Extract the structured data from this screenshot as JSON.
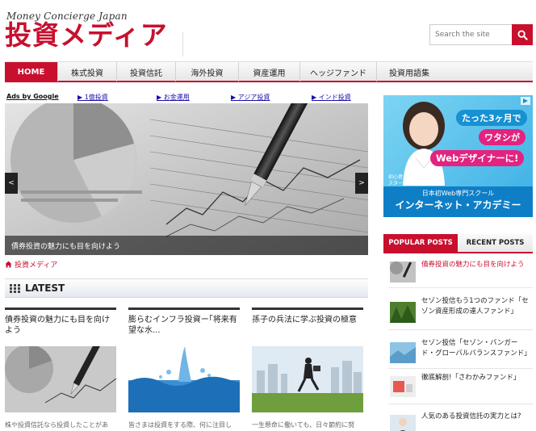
{
  "site": {
    "tagline": "Money Concierge Japan",
    "logo": "投資メディア"
  },
  "search": {
    "placeholder": "Search the site"
  },
  "nav": {
    "items": [
      "HOME",
      "株式投資",
      "投資信託",
      "海外投資",
      "資産運用",
      "ヘッジファンド",
      "投資用語集"
    ]
  },
  "adlinks": {
    "label": "Ads by Google",
    "links": [
      "▶ 1億投資",
      "▶ お金運用",
      "▶ アジア投資",
      "▶ インド投資"
    ]
  },
  "slider": {
    "caption": "債券投資の魅力にも目を向けよう",
    "prev": "<",
    "next": ">"
  },
  "breadcrumb": {
    "label": "投資メディア"
  },
  "latest": {
    "title": "LATEST",
    "cards": [
      {
        "title": "債券投資の魅力にも目を向けよう",
        "excerpt": "株や投資信託なら投資したことがあ"
      },
      {
        "title": "膨らむインフラ投資ー｢将来有望な水...",
        "excerpt": "皆さまは投資をする際、何に注目し"
      },
      {
        "title": "孫子の兵法に学ぶ投資の極意",
        "excerpt": "一生懸命に働いても、日々節約に努"
      }
    ]
  },
  "sidebar_ad": {
    "line1": "たった3ヶ月で",
    "line2": "ワタシが",
    "line3": "Webデザイナーに!",
    "small1": "初心者から",
    "small2": "スタートしたユカさん",
    "school1": "日本初Web専門スクール",
    "school2": "インターネット・アカデミー"
  },
  "sidebar_tabs": {
    "popular": "POPULAR POSTS",
    "recent": "RECENT POSTS"
  },
  "popular_posts": [
    "債券投資の魅力にも目を向けよう",
    "セゾン投信もう1つのファンド「セゾン資産形成の達人ファンド」",
    "セゾン投信「セゾン・バンガード・グローバルバランスファンド」",
    "徹底解剖!「さわかみファンド」",
    "人気のある投資信託の実力とは?"
  ],
  "colors": {
    "accent": "#c8102e",
    "link": "#1a0dab"
  }
}
